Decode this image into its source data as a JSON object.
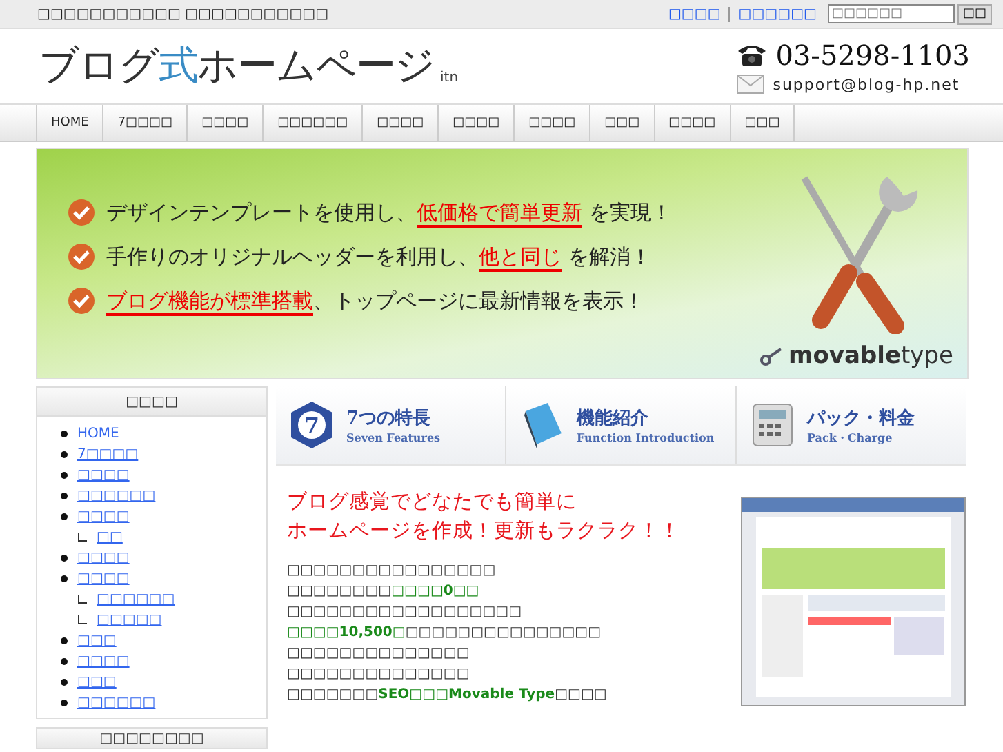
{
  "top_bar": {
    "tagline": "□□□□□□□□□□□ □□□□□□□□□□□",
    "links": [
      "□□□□",
      "□□□□□□"
    ],
    "search": {
      "placeholder": "□□□□□□"
    },
    "search_button": "□□"
  },
  "header": {
    "logo": "ブログ**式**ホームページ",
    "logo_suffix": "itn",
    "phone": "03-5298-1103",
    "email": "support@blog-hp.net"
  },
  "nav": [
    "HOME",
    "7□□□□",
    "□□□□",
    "□□□□□□",
    "□□□□",
    "□□□□",
    "□□□□",
    "□□□",
    "□□□□",
    "□□□"
  ],
  "banner": {
    "lines": [
      "デザインテンプレートを使用し、**低価格で簡単更新** を実現！",
      "手作りのオリジナルヘッダーを利用し、**他と同じ** を解消！",
      "**ブログ機能が標準搭載**、トップページに最新情報を表示！"
    ],
    "logo": "**movable**type"
  },
  "sidebar": {
    "title": "□□□□",
    "items": [
      {
        "label": "HOME",
        "kind": "plain"
      },
      {
        "label": "7□□□□",
        "kind": "link"
      },
      {
        "label": "□□□□",
        "kind": "link"
      },
      {
        "label": "□□□□□□",
        "kind": "link"
      },
      {
        "label": "□□□□",
        "kind": "link",
        "children": [
          {
            "label": "□□"
          }
        ]
      },
      {
        "label": "□□□□",
        "kind": "link"
      },
      {
        "label": "□□□□",
        "kind": "link",
        "children": [
          {
            "label": "□□□□□□"
          },
          {
            "label": "□□□□□"
          }
        ]
      },
      {
        "label": "□□□",
        "kind": "link"
      },
      {
        "label": "□□□□",
        "kind": "link"
      },
      {
        "label": "□□□",
        "kind": "link"
      },
      {
        "label": "□□□□□□",
        "kind": "link"
      }
    ]
  },
  "sidebar_second": {
    "title": "□□□□□□□□"
  },
  "features": [
    {
      "kind": "seven",
      "icon_text": "7",
      "title": "7つの特長",
      "subtitle": "Seven Features"
    },
    {
      "kind": "book",
      "title": "機能紹介",
      "subtitle": "Function Introduction"
    },
    {
      "kind": "calculator",
      "title": "パック・料金",
      "subtitle": "Pack・Charge"
    }
  ],
  "intro": {
    "headline": [
      "ブログ感覚でどなたでも簡単に",
      "ホームページを作成！更新もラクラク！！"
    ],
    "lines": [
      "□□□□□□□□□□□□□□□□",
      "□□□□□□□□**□□□□0□□**",
      "□□□□□□□□□□□□□□□□□□",
      "**□□□□10,500□**□□□□□□□□□□□□□□□",
      "□□□□□□□□□□□□□□",
      "□□□□□□□□□□□□□□",
      "□□□□□□□**SEO□□□Movable Type**□□□□"
    ]
  }
}
